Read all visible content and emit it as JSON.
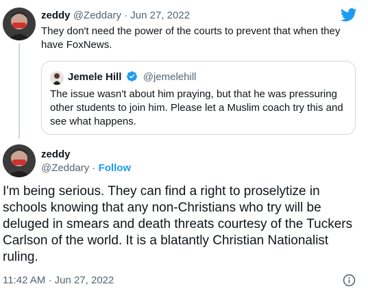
{
  "reply_tweet": {
    "author_name": "zeddy",
    "author_handle": "@Zeddary",
    "separator": "·",
    "date": "Jun 27, 2022",
    "text": "They don't need the power of the courts to prevent that when they have FoxNews."
  },
  "quoted_tweet": {
    "author_name": "Jemele Hill",
    "author_handle": "@jemelehill",
    "verified": true,
    "text": "The issue wasn't about him praying, but that he was pressuring other students to join him. Please let a Muslim coach try this and see what happens."
  },
  "main_tweet": {
    "author_name": "zeddy",
    "author_handle": "@Zeddary",
    "separator": "·",
    "follow_label": "Follow",
    "text": "I'm being serious. They can find a right to proselytize in schools knowing that any non-Christians who try will be deluged in smears and death threats courtesy of the Tuckers Carlson of the world. It is a blatantly Christian Nationalist ruling.",
    "time": "11:42 AM",
    "date": "Jun 27, 2022"
  },
  "icons": {
    "brand": "twitter-bird-icon",
    "verified": "verified-badge-icon",
    "info": "info-icon"
  },
  "colors": {
    "text": "#0f1419",
    "secondary_text": "#536471",
    "accent": "#1d9bf0",
    "border": "#cfd9de"
  }
}
